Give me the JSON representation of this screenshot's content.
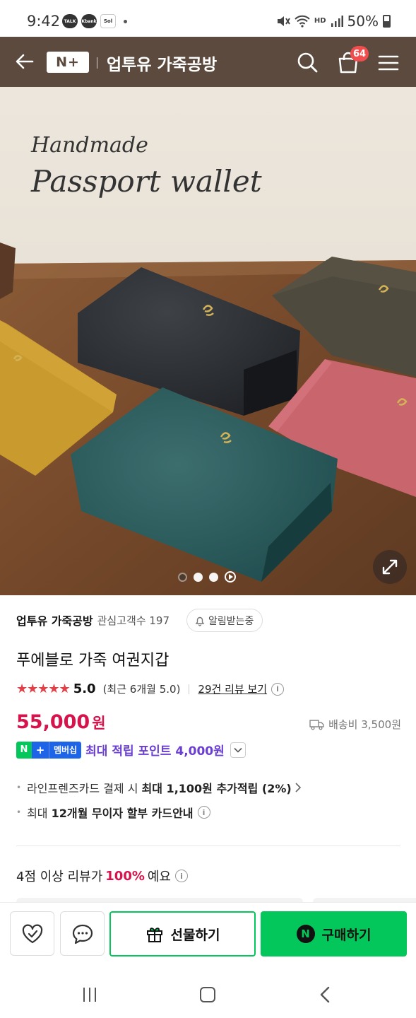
{
  "status_bar": {
    "time": "9:42",
    "apps": [
      "TALK",
      "Kbank",
      "Sol"
    ],
    "battery": "50%"
  },
  "header": {
    "logo": "N+",
    "store_title": "업투유 가죽공방",
    "cart_count": "64",
    "bg_color": "#5b4a3d"
  },
  "hero": {
    "overlay_line1": "Handmade",
    "overlay_line2": "Passport wallet",
    "slide_count": 3,
    "active_slide": 1
  },
  "store": {
    "name": "업투유 가죽공방",
    "fans_label": "관심고객수 197",
    "notify_label": "알림받는중"
  },
  "product": {
    "title": "푸에블로 가죽 여권지갑",
    "stars": "★★★★★",
    "score": "5.0",
    "recent_rating": "(최근 6개월 5.0)",
    "review_link": "29건 리뷰 보기",
    "price": "55,000",
    "price_unit": "원",
    "shipping": "배송비 3,500원",
    "accent_color": "#d6134b"
  },
  "membership": {
    "badge_n": "N",
    "badge_plus": "+",
    "badge_label": "멤버십",
    "points_text": "최대 적립 포인트 4,000원"
  },
  "benefits": [
    {
      "prefix": "라인프렌즈카드 결제 시 ",
      "bold": "최대 1,100원 추가적립 (2%)"
    },
    {
      "prefix": "최대 ",
      "bold": "12개월 무이자 할부 카드안내"
    }
  ],
  "review_summary": {
    "prefix": "4점 이상 리뷰가",
    "highlight": "100%",
    "suffix": "예요"
  },
  "actions": {
    "gift_label": "선물하기",
    "buy_label": "구매하기",
    "buy_color": "#03c75a"
  }
}
